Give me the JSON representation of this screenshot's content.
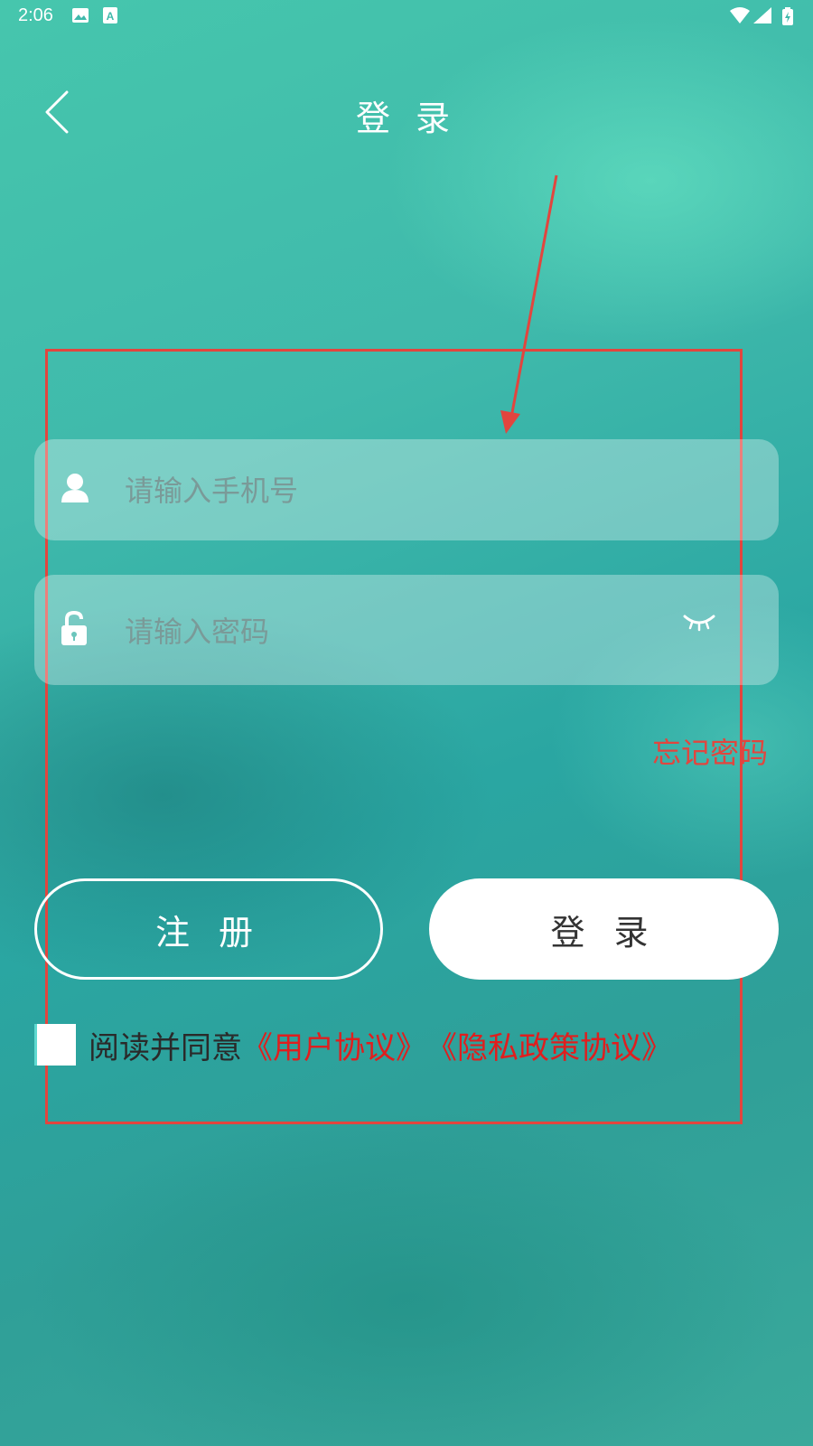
{
  "status_bar": {
    "time": "2:06",
    "icons": [
      "image-icon",
      "font-icon",
      "wifi-icon",
      "signal-icon",
      "battery-icon"
    ]
  },
  "header": {
    "title": "登 录",
    "back_icon": "chevron-left-icon"
  },
  "form": {
    "phone_placeholder": "请输入手机号",
    "password_placeholder": "请输入密码",
    "phone_icon": "user-icon",
    "password_icon": "unlock-icon",
    "visibility_icon": "eye-closed-icon",
    "forgot_password": "忘记密码"
  },
  "buttons": {
    "register": "注 册",
    "login": "登 录"
  },
  "agreement": {
    "prefix": "阅读并同意",
    "user_agreement": "《用户协议》",
    "privacy_policy": "《隐私政策协议》"
  },
  "colors": {
    "annotation": "#e2453e",
    "link": "#e01e1e",
    "background": "#3fb9ab"
  }
}
